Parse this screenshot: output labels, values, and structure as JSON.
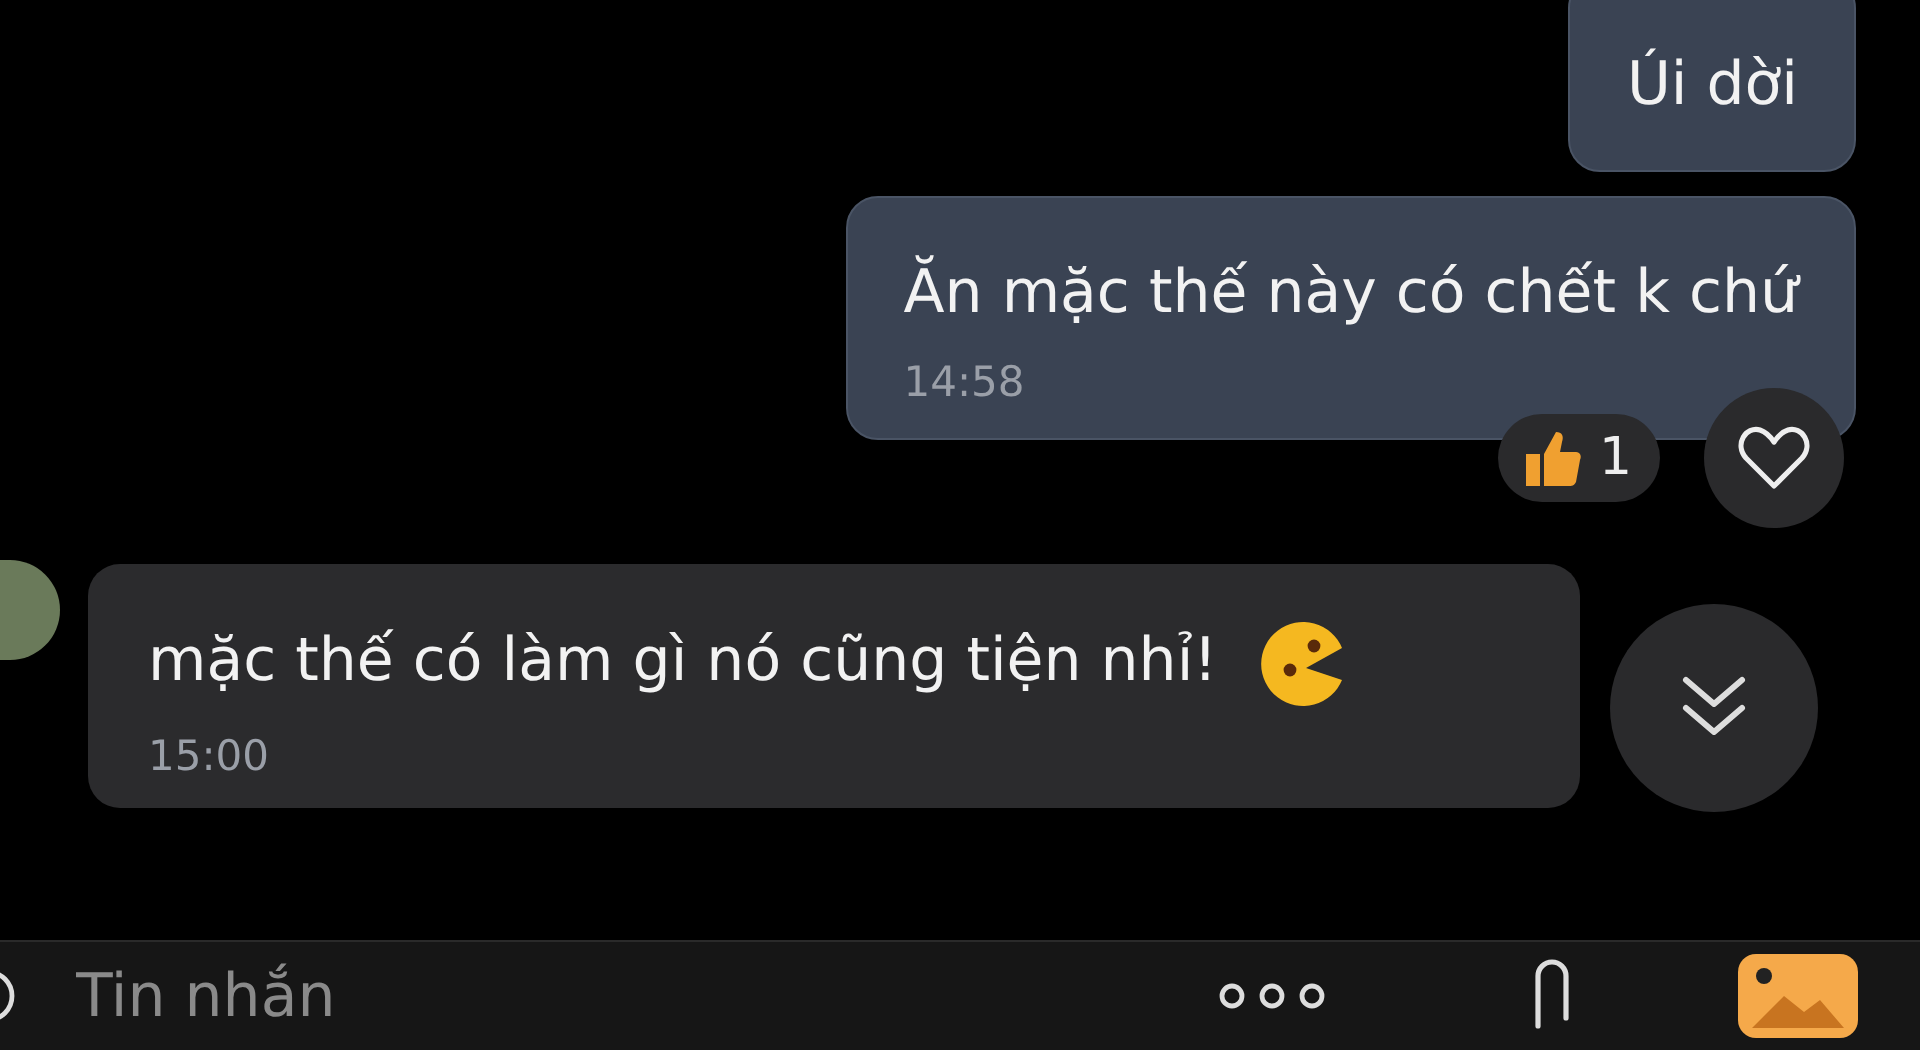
{
  "messages": [
    {
      "kind": "sent",
      "text": "Úi dời"
    },
    {
      "kind": "sent",
      "text": "Ăn mặc thế này có chết k chứ",
      "time": "14:58",
      "reaction_count": "1"
    },
    {
      "kind": "received",
      "text": "mặc thế có làm gì nó cũng tiện nhỉ!",
      "time": "15:00",
      "has_emoji": true
    }
  ],
  "composer": {
    "placeholder": "Tin nhắn"
  }
}
